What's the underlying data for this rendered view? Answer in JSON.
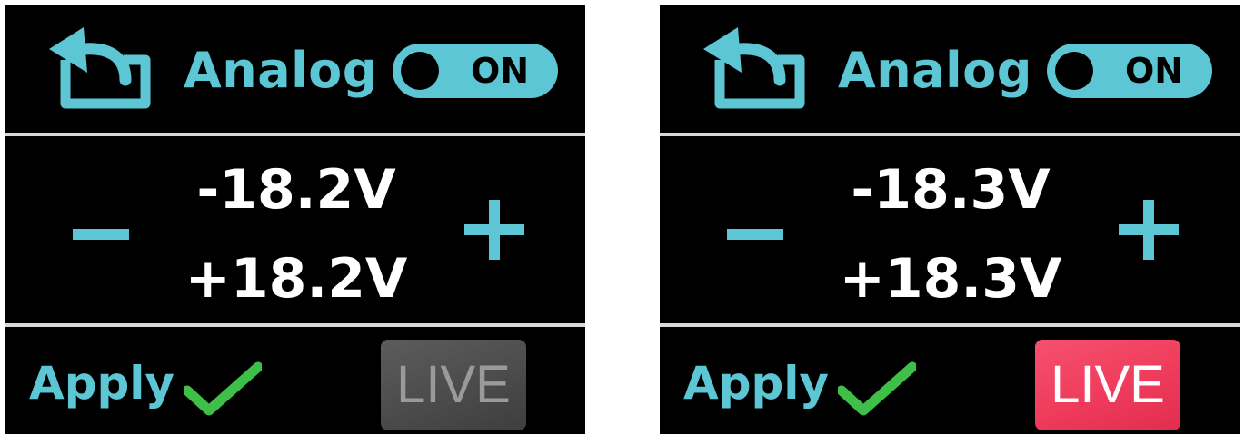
{
  "colors": {
    "accent": "#5cc6d4",
    "background": "#000000",
    "divider": "#d8d8d8",
    "check": "#3ec048",
    "live_inactive": "#4a4a4a",
    "live_active": "#ee3a5a"
  },
  "screens": [
    {
      "title": "Analog",
      "back_icon": "back-arrow-icon",
      "toggle_label": "ON",
      "minus_icon": "minus-icon",
      "plus_icon": "plus-icon",
      "negative_voltage": "-18.2V",
      "positive_voltage": "+18.2V",
      "apply_label": "Apply",
      "apply_icon": "checkmark-icon",
      "live_label": "LIVE",
      "live_state": "inactive"
    },
    {
      "title": "Analog",
      "back_icon": "back-arrow-icon",
      "toggle_label": "ON",
      "minus_icon": "minus-icon",
      "plus_icon": "plus-icon",
      "negative_voltage": "-18.3V",
      "positive_voltage": "+18.3V",
      "apply_label": "Apply",
      "apply_icon": "checkmark-icon",
      "live_label": "LIVE",
      "live_state": "active"
    }
  ]
}
